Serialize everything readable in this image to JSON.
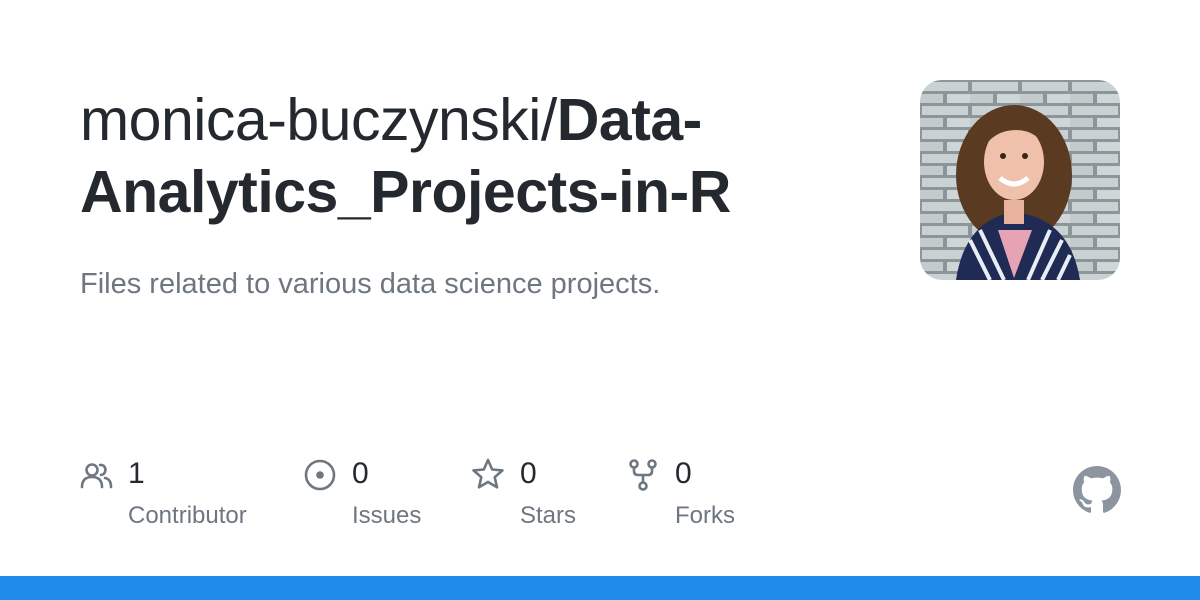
{
  "repo": {
    "owner": "monica-buczynski/",
    "name": "Data-Analytics_Projects-in-R",
    "description": "Files related to various data science projects."
  },
  "stats": [
    {
      "icon": "people-icon",
      "count": "1",
      "label": "Contributor"
    },
    {
      "icon": "issue-icon",
      "count": "0",
      "label": "Issues"
    },
    {
      "icon": "star-icon",
      "count": "0",
      "label": "Stars"
    },
    {
      "icon": "fork-icon",
      "count": "0",
      "label": "Forks"
    }
  ],
  "brand": {
    "icon": "github-icon",
    "bar_color": "#1f8ceb"
  }
}
